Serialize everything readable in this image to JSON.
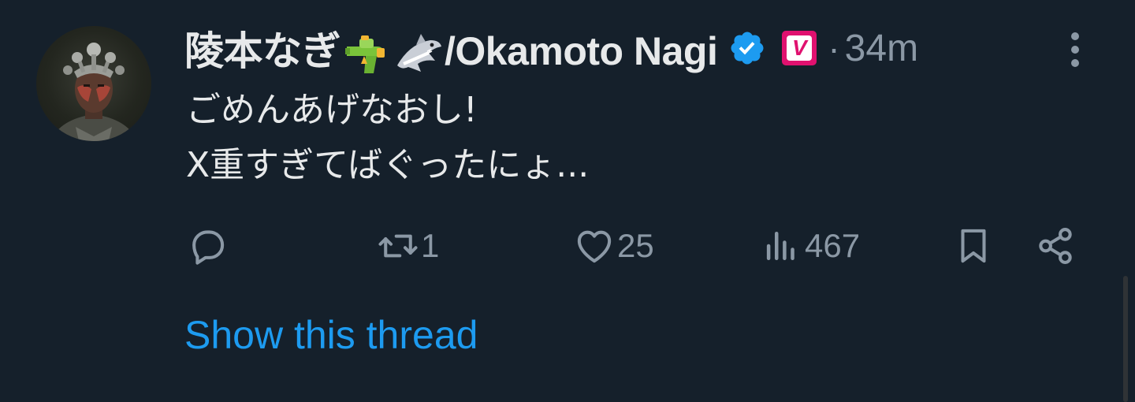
{
  "tweet": {
    "author": {
      "name_part1": "陵本なぎ",
      "name_part2": "/Okamoto Nagi",
      "emojis": [
        "water-pistol-emoji",
        "shark-emoji"
      ],
      "verified_icon": "verified-badge-icon",
      "badge_letter": "V",
      "avatar": "avatar-image"
    },
    "timestamp_separator": "·",
    "timestamp": "34m",
    "more_icon": "more-vertical-icon",
    "text_lines": [
      "ごめんあげなおし!",
      "X重すぎてばぐったにょ..."
    ],
    "actions": {
      "reply": {
        "icon": "reply-icon",
        "count": ""
      },
      "retweet": {
        "icon": "retweet-icon",
        "count": "1"
      },
      "like": {
        "icon": "heart-icon",
        "count": "25"
      },
      "views": {
        "icon": "views-chart-icon",
        "count": "467"
      },
      "bookmark": {
        "icon": "bookmark-icon"
      },
      "share": {
        "icon": "share-icon"
      }
    },
    "show_thread_label": "Show this thread",
    "colors": {
      "background": "#15202b",
      "text": "#e7e9ea",
      "muted": "#8b98a5",
      "link": "#1d9bf0",
      "verified": "#1d9bf0",
      "badge": "#e0116f"
    }
  }
}
